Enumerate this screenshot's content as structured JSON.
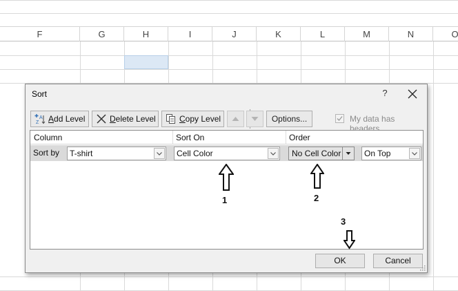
{
  "spreadsheet": {
    "columns": [
      "F",
      "G",
      "H",
      "I",
      "J",
      "K",
      "L",
      "M",
      "N",
      "O"
    ]
  },
  "dialog": {
    "title": "Sort",
    "help_label": "?",
    "toolbar": {
      "add_level": "Add Level",
      "delete_level": "Delete Level",
      "copy_level": "Copy Level",
      "options": "Options..."
    },
    "my_data_has_headers": {
      "label": "My data has headers",
      "checked": true
    },
    "headers": {
      "column": "Column",
      "sort_on": "Sort On",
      "order": "Order"
    },
    "rows": [
      {
        "label": "Sort by",
        "column": "T-shirt",
        "sort_on": "Cell Color",
        "order_color": "No Cell Color",
        "order_position": "On Top"
      }
    ],
    "ok": "OK",
    "cancel": "Cancel"
  },
  "annotations": [
    "1",
    "2",
    "3"
  ],
  "colors": {
    "selected_cell": "#dce8f5",
    "dialog_bg": "#f0f0f0",
    "row_highlight": "#dadada"
  }
}
